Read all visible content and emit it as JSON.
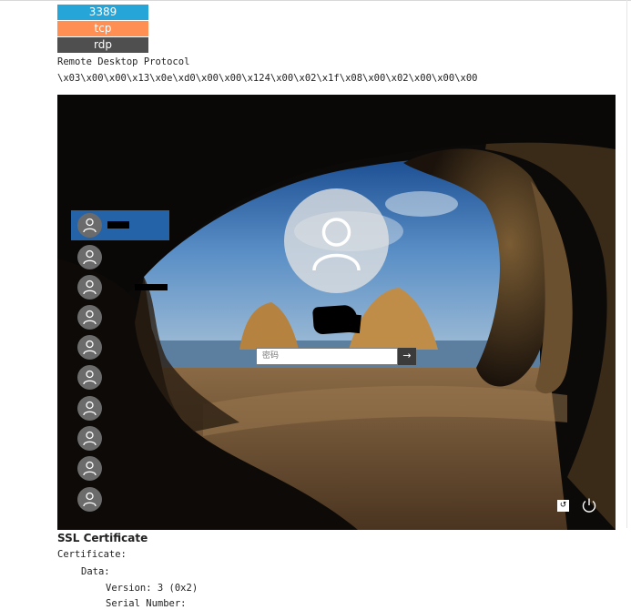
{
  "badges": {
    "port": "3389",
    "transport": "tcp",
    "service": "rdp"
  },
  "service_name": "Remote Desktop Protocol",
  "banner": "\\x03\\x00\\x00\\x13\\x0e\\xd0\\x00\\x00\\x124\\x00\\x02\\x1f\\x08\\x00\\x02\\x00\\x00\\x00",
  "screenshot": {
    "password_placeholder": "密码",
    "submit_glyph": "→",
    "ease_glyph": "↺",
    "user_tiles": 10
  },
  "ssl": {
    "title": "SSL Certificate",
    "lines": [
      "Certificate:",
      "Data:",
      "Version: 3 (0x2)",
      "Serial Number:"
    ]
  }
}
